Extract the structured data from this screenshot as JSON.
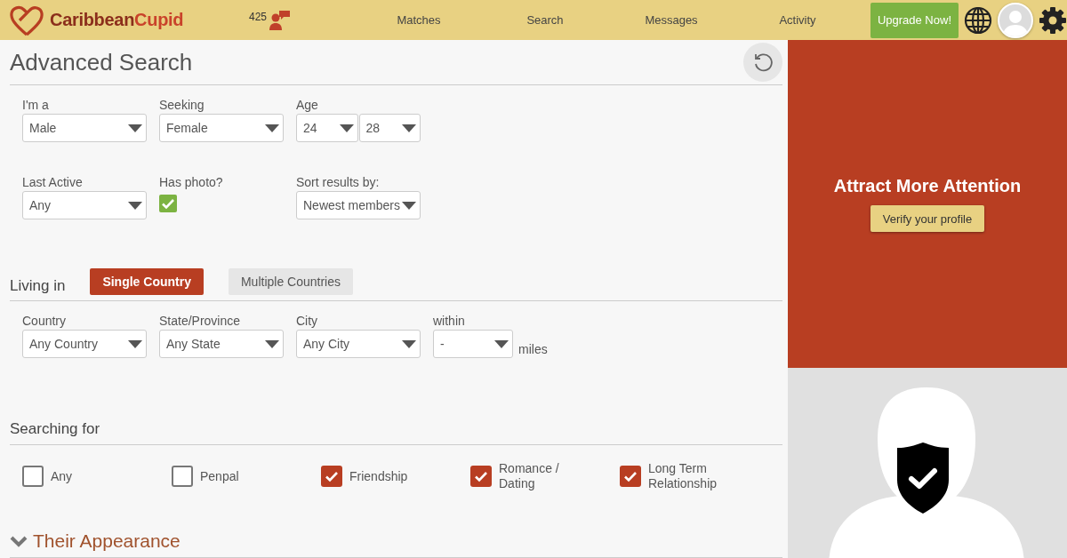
{
  "header": {
    "logo": {
      "first": "Caribbean",
      "second": "Cupid"
    },
    "message_count": "425",
    "nav": [
      {
        "label": "Matches",
        "selected": false
      },
      {
        "label": "Search",
        "selected": false
      },
      {
        "label": "Messages",
        "selected": false
      },
      {
        "label": "Activity",
        "selected": false
      }
    ],
    "upgrade_button": "Upgrade Now!"
  },
  "page": {
    "title": "Advanced Search",
    "basic_rows": [
      [
        {
          "kind": "select",
          "label": "I'm a",
          "value": "Male"
        },
        {
          "kind": "select",
          "label": "Seeking",
          "value": "Female"
        },
        {
          "kind": "range",
          "label": "Age",
          "values": [
            "24",
            "28"
          ]
        }
      ],
      [
        {
          "kind": "select",
          "label": "Last Active",
          "value": "Any"
        },
        {
          "kind": "checkbox",
          "label": "Has photo?",
          "checked": true
        },
        {
          "kind": "select",
          "label": "Sort results by:",
          "value": "Newest members"
        }
      ]
    ],
    "living_in": {
      "label": "Living in",
      "tabs": [
        {
          "label": "Single Country",
          "selected": true
        },
        {
          "label": "Multiple Countries",
          "selected": false
        }
      ],
      "fields": [
        {
          "label": "Country",
          "value": "Any Country"
        },
        {
          "label": "State/Province",
          "value": "Any State"
        },
        {
          "label": "City",
          "value": "Any City"
        },
        {
          "label": "within",
          "value": "-",
          "unit": "miles"
        }
      ]
    },
    "searching_for": {
      "label": "Searching for",
      "options": [
        {
          "label": "Any",
          "checked": false
        },
        {
          "label": "Penpal",
          "checked": false
        },
        {
          "label": "Friendship",
          "checked": true
        },
        {
          "label": "Romance / Dating",
          "checked": true
        },
        {
          "label": "Long Term Relationship",
          "checked": true
        }
      ]
    },
    "appearance": {
      "label": "Their Appearance"
    }
  },
  "promo": {
    "title": "Attract More Attention",
    "button": "Verify your profile"
  }
}
